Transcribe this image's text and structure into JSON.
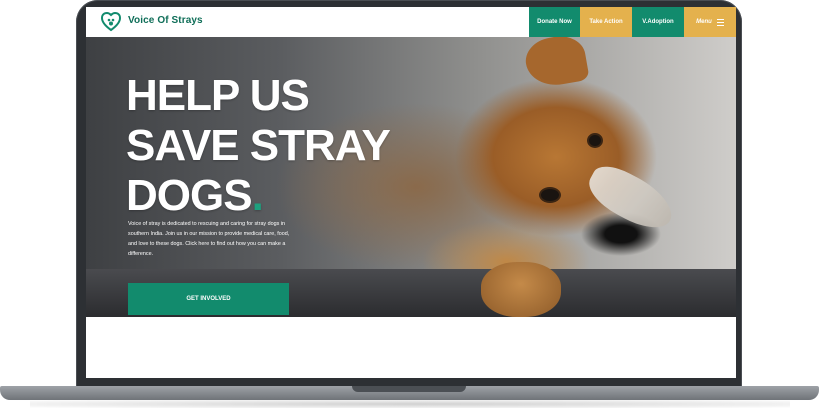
{
  "site": {
    "brand": "Voice Of Strays"
  },
  "nav": {
    "donate_label": "Donate Now",
    "action_label": "Take Action",
    "adopt_label": "V.Adoption",
    "menu_label": "Menu"
  },
  "hero": {
    "title_line1": "HELP US",
    "title_line2": "SAVE STRAY",
    "title_line3": "DOGS",
    "title_dot": ".",
    "description": "Voice of stray is dedicated to rescuing and caring for stray dogs in southern India. Join us in our mission to provide medical care, food, and love to these dogs. Click here to find out how you can make a difference.",
    "cta_label": "GET INVOLVED"
  },
  "colors": {
    "green": "#128b6d",
    "gold": "#e4b14d",
    "brand_text": "#0f6e58"
  },
  "icons": {
    "logo": "heart-paw-icon",
    "menu": "hamburger-icon"
  }
}
